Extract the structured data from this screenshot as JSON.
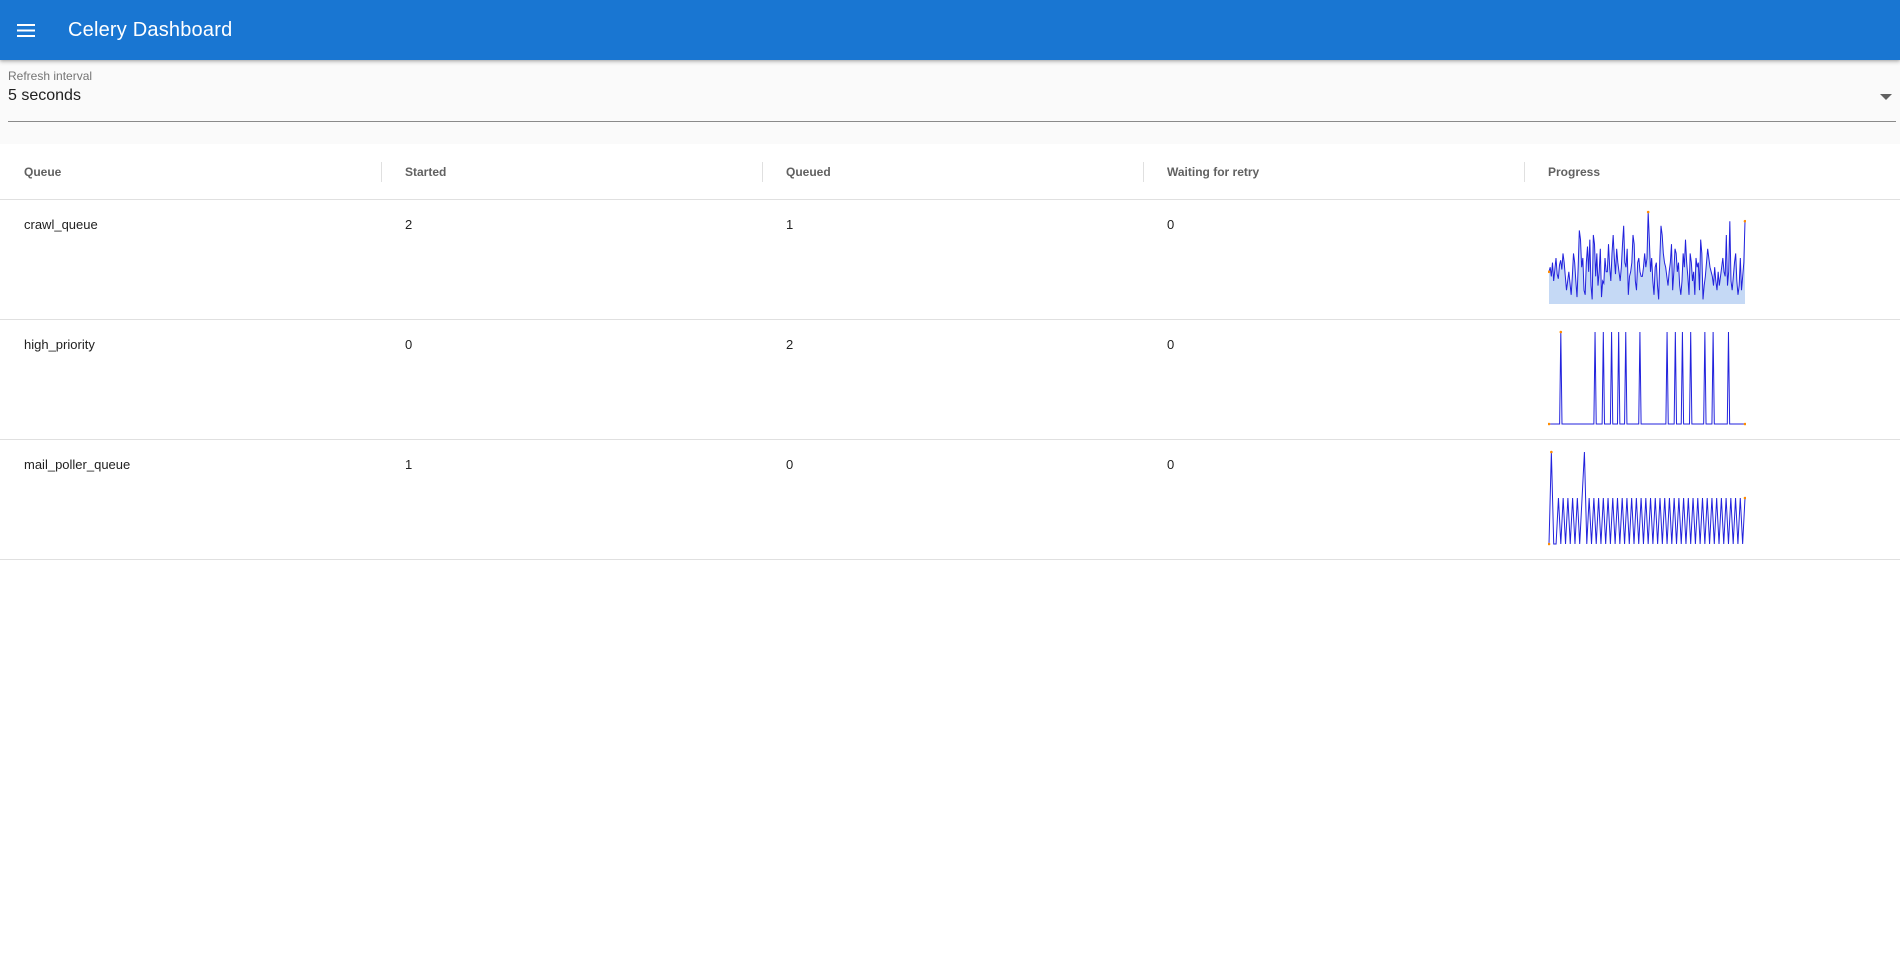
{
  "app_bar": {
    "title": "Celery Dashboard",
    "menu_icon": "menu-icon",
    "background": "#1976d2"
  },
  "refresh": {
    "label": "Refresh interval",
    "value": "5 seconds"
  },
  "table": {
    "columns": [
      "Queue",
      "Started",
      "Queued",
      "Waiting for retry",
      "Progress"
    ],
    "rows": [
      {
        "queue": "crawl_queue",
        "started": "2",
        "queued": "1",
        "waiting": "0",
        "progress": [
          14,
          16,
          12,
          18,
          10,
          15,
          20,
          13,
          11,
          17,
          19,
          15,
          22,
          18,
          12,
          6,
          10,
          14,
          9,
          4,
          12,
          22,
          18,
          10,
          3,
          16,
          32,
          28,
          16,
          20,
          6,
          4,
          18,
          25,
          14,
          28,
          8,
          2,
          30,
          26,
          12,
          22,
          8,
          14,
          24,
          3,
          10,
          9,
          20,
          14,
          14,
          26,
          16,
          10,
          22,
          30,
          20,
          13,
          24,
          18,
          14,
          10,
          16,
          26,
          34,
          18,
          16,
          24,
          4,
          12,
          14,
          18,
          30,
          26,
          10,
          6,
          18,
          20,
          14,
          12,
          12,
          16,
          22,
          16,
          20,
          40,
          28,
          14,
          20,
          10,
          4,
          16,
          18,
          8,
          2,
          20,
          34,
          30,
          22,
          18,
          16,
          12,
          8,
          14,
          18,
          26,
          6,
          14,
          24,
          22,
          14,
          18,
          8,
          4,
          10,
          22,
          16,
          28,
          18,
          12,
          4,
          22,
          18,
          10,
          14,
          4,
          20,
          16,
          18,
          6,
          28,
          22,
          2,
          8,
          12,
          18,
          24,
          20,
          16,
          14,
          12,
          8,
          16,
          10,
          6,
          14,
          8,
          12,
          16,
          20,
          14,
          12,
          30,
          8,
          14,
          36,
          10,
          6,
          12,
          18,
          22,
          10,
          4,
          8,
          20,
          6,
          12,
          18,
          36
        ],
        "progress_color": "#2222dd",
        "progress_fill": "#c5d9f5"
      },
      {
        "queue": "high_priority",
        "started": "0",
        "queued": "2",
        "waiting": "0",
        "progress": [
          0,
          0,
          0,
          0,
          0,
          0,
          0,
          0,
          0,
          0,
          1,
          0,
          0,
          0,
          0,
          0,
          0,
          0,
          0,
          0,
          0,
          0,
          0,
          0,
          0,
          0,
          0,
          0,
          0,
          0,
          0,
          0,
          0,
          0,
          0,
          0,
          0,
          0,
          0,
          1,
          0,
          0,
          0,
          0,
          0,
          0,
          1,
          0,
          0,
          0,
          0,
          0,
          0,
          1,
          0,
          0,
          0,
          0,
          0,
          1,
          0,
          0,
          0,
          0,
          0,
          1,
          0,
          0,
          0,
          0,
          0,
          0,
          0,
          0,
          0,
          0,
          0,
          1,
          0,
          0,
          0,
          0,
          0,
          0,
          0,
          0,
          0,
          0,
          0,
          0,
          0,
          0,
          0,
          0,
          0,
          0,
          0,
          0,
          0,
          0,
          1,
          0,
          0,
          0,
          0,
          0,
          0,
          1,
          0,
          0,
          0,
          0,
          0,
          1,
          0,
          0,
          0,
          0,
          0,
          0,
          1,
          0,
          0,
          0,
          0,
          0,
          0,
          0,
          0,
          0,
          0,
          0,
          1,
          0,
          0,
          0,
          0,
          0,
          0,
          1,
          0,
          0,
          0,
          0,
          0,
          0,
          0,
          0,
          0,
          0,
          0,
          0,
          1,
          0,
          0,
          0,
          0,
          0,
          0,
          0,
          0,
          0,
          0,
          0,
          0,
          0,
          0
        ],
        "progress_color": "#2222dd",
        "progress_fill": "#ffffff"
      },
      {
        "queue": "mail_poller_queue",
        "started": "1",
        "queued": "0",
        "waiting": "0",
        "progress": [
          0,
          2,
          0,
          0,
          1,
          0,
          1,
          0,
          1,
          0,
          1,
          0,
          1,
          0,
          1,
          2,
          0,
          1,
          0,
          1,
          0,
          1,
          0,
          1,
          0,
          1,
          0,
          1,
          0,
          1,
          0,
          1,
          0,
          1,
          0,
          1,
          0,
          1,
          0,
          1,
          0,
          1,
          0,
          1,
          0,
          1,
          0,
          1,
          0,
          1,
          0,
          1,
          0,
          1,
          0,
          1,
          0,
          1,
          0,
          1,
          0,
          1,
          0,
          1,
          0,
          1,
          0,
          1,
          0,
          1,
          0,
          1,
          0,
          1,
          0,
          1,
          0,
          1,
          0,
          1,
          0,
          1,
          0,
          1
        ],
        "progress_color": "#2222dd",
        "progress_fill": "#ffffff"
      }
    ]
  }
}
